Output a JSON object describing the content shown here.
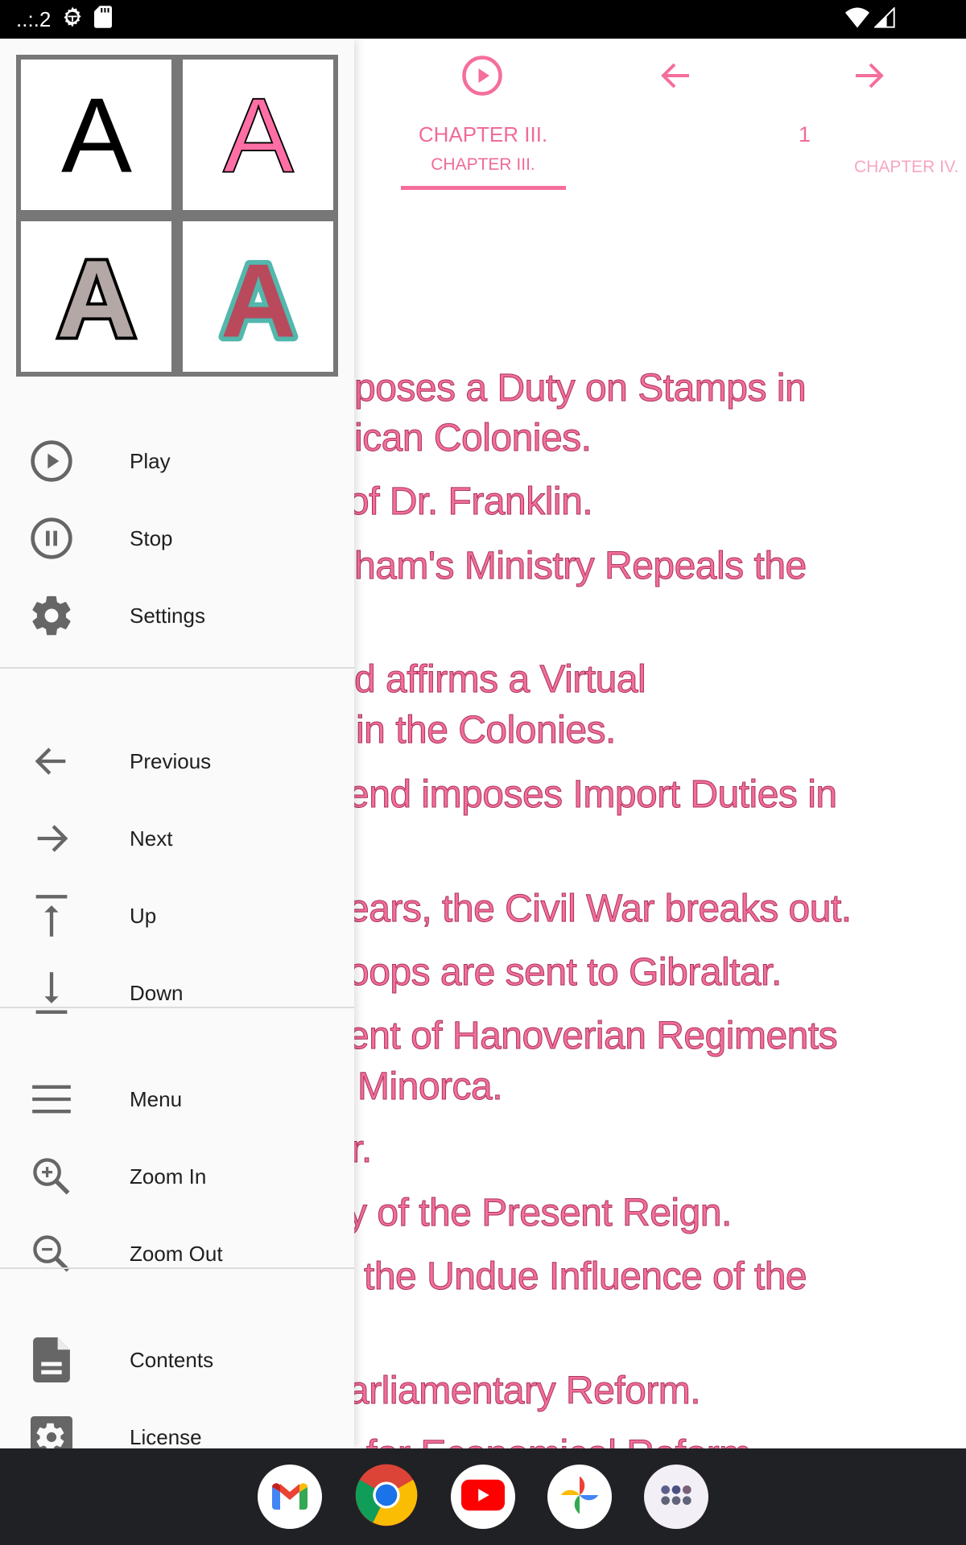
{
  "status_bar": {
    "left_text": "..:.2",
    "icons": [
      "debug-icon",
      "sd-card-icon"
    ],
    "right_icons": [
      "wifi-icon",
      "cellular-signal-icon"
    ]
  },
  "reader": {
    "toolbar": {
      "play_button": "play-circle-icon",
      "previous_button": "arrow-left-icon",
      "next_button": "arrow-right-icon",
      "current_tab": {
        "title": "CHAPTER III.",
        "subtitle": "CHAPTER III."
      },
      "page_number": "1",
      "next_tab_label": "CHAPTER IV."
    },
    "lines": [
      "poses a Duty on Stamps in",
      "ican Colonies.",
      "of Dr. Franklin.",
      "ham's Ministry Repeals the",
      "d affirms a Virtual",
      "in the Colonies.",
      "end imposes Import Duties in",
      "ears, the Civil War breaks out.",
      "oops are sent to Gibraltar.",
      "ent of Hanoverian Regiments",
      "Minorca.",
      "r.",
      "y of the Present Reign.",
      "the Undue Influence of the",
      "arliamentary Reform.",
      "l for Economical Reform."
    ],
    "text_color": "#f36e9b",
    "accent_color": "#f56e9c"
  },
  "drawer": {
    "font_styles": [
      {
        "glyph": "A",
        "name": "plain-black"
      },
      {
        "glyph": "A",
        "name": "pink-outlined"
      },
      {
        "glyph": "A",
        "name": "grey-black-outline"
      },
      {
        "glyph": "A",
        "name": "red-teal-outline"
      }
    ],
    "groups": [
      [
        {
          "label": "Play",
          "icon": "play-circle-icon"
        },
        {
          "label": "Stop",
          "icon": "pause-circle-icon"
        },
        {
          "label": "Settings",
          "icon": "gear-icon"
        }
      ],
      [
        {
          "label": "Previous",
          "icon": "arrow-left-icon"
        },
        {
          "label": "Next",
          "icon": "arrow-right-icon"
        },
        {
          "label": "Up",
          "icon": "arrow-to-top-icon"
        },
        {
          "label": "Down",
          "icon": "arrow-to-bottom-icon"
        }
      ],
      [
        {
          "label": "Menu",
          "icon": "hamburger-menu-icon"
        },
        {
          "label": "Zoom In",
          "icon": "zoom-in-icon"
        },
        {
          "label": "Zoom Out",
          "icon": "zoom-out-icon"
        }
      ],
      [
        {
          "label": "Contents",
          "icon": "document-icon"
        },
        {
          "label": "License",
          "icon": "settings-box-icon"
        }
      ]
    ]
  },
  "dock": {
    "apps": [
      {
        "name": "Gmail"
      },
      {
        "name": "Chrome"
      },
      {
        "name": "YouTube"
      },
      {
        "name": "Photos"
      },
      {
        "name": "App drawer"
      }
    ]
  }
}
